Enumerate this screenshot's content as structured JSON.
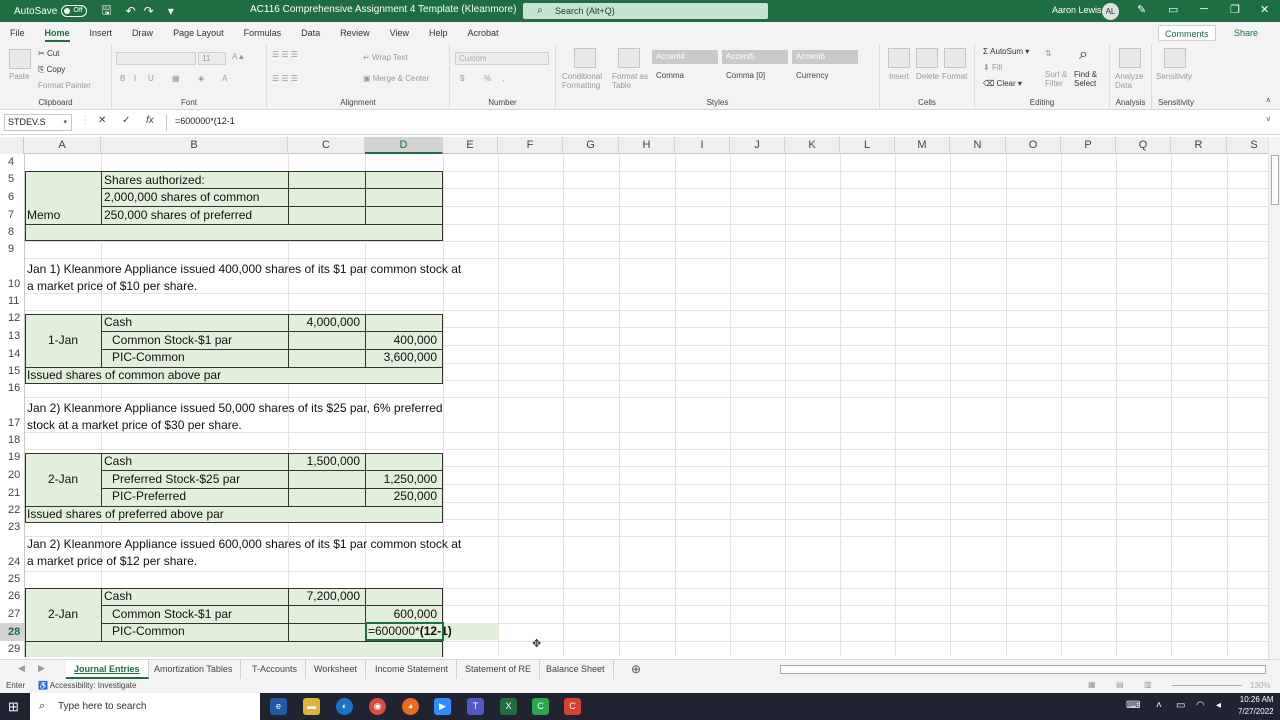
{
  "titlebar": {
    "autosave_label": "AutoSave",
    "autosave_state": "Off",
    "doc_title": "AC116 Comprehensive Assignment 4 Template (Kleanmore)",
    "search_placeholder": "Search (Alt+Q)",
    "user_name": "Aaron Lewis",
    "user_initials": "AL"
  },
  "ribbon_tabs": [
    "File",
    "Home",
    "Insert",
    "Draw",
    "Page Layout",
    "Formulas",
    "Data",
    "Review",
    "View",
    "Help",
    "Acrobat"
  ],
  "active_tab": "Home",
  "ribbon_actions": {
    "comments": "Comments",
    "share": "Share"
  },
  "ribbon": {
    "clipboard": {
      "label": "Clipboard",
      "paste": "Paste",
      "cut": "Cut",
      "copy": "Copy",
      "format_painter": "Format Painter"
    },
    "font": {
      "label": "Font",
      "bold": "B",
      "italic": "I",
      "underline": "U",
      "font_size": "11"
    },
    "alignment": {
      "label": "Alignment",
      "wrap_text": "Wrap Text",
      "merge_center": "Merge & Center"
    },
    "number": {
      "label": "Number",
      "format": "Custom",
      "percent": "%",
      "comma": ",",
      "currency": "$"
    },
    "styles": {
      "label": "Styles",
      "conditional": "Conditional Formatting",
      "format_table": "Format as Table",
      "cell_styles": [
        "Accent4",
        "Accent5",
        "Accent6",
        "Comma",
        "Comma [0]",
        "Currency"
      ]
    },
    "cells": {
      "label": "Cells",
      "insert": "Insert",
      "delete": "Delete",
      "format": "Format"
    },
    "editing": {
      "label": "Editing",
      "autosum": "AutoSum",
      "fill": "Fill",
      "clear": "Clear",
      "sort_filter": "Sort & Filter",
      "find_select": "Find & Select"
    },
    "analysis": {
      "label": "Analysis",
      "analyze_data": "Analyze Data"
    },
    "sensitivity": {
      "label": "Sensitivity",
      "sensitivity": "Sensitivity"
    }
  },
  "formula_bar": {
    "name_box": "STDEV.S",
    "cancel": "✕",
    "enter": "✓",
    "fx": "fx",
    "formula": "=600000*(12-1"
  },
  "columns": [
    "A",
    "B",
    "C",
    "D",
    "E",
    "F",
    "G",
    "H",
    "I",
    "J",
    "K",
    "L",
    "M",
    "N",
    "O",
    "P",
    "Q",
    "R",
    "S"
  ],
  "rows": [
    "4",
    "5",
    "6",
    "7",
    "8",
    "9",
    "10",
    "11",
    "12",
    "13",
    "14",
    "15",
    "16",
    "17",
    "18",
    "19",
    "20",
    "21",
    "22",
    "23",
    "24",
    "25",
    "26",
    "27",
    "28",
    "29"
  ],
  "cells": {
    "r5b": "Shares authorized:",
    "r6b": "2,000,000 shares of common",
    "r7a": "Memo",
    "r7b": "250,000 shares of preferred",
    "r10_line1": "Jan 1) Kleanmore Appliance issued 400,000 shares of its $1 par common stock at",
    "r10_line2": "a market price of $10 per share.",
    "r12b": "Cash",
    "r12c": "4,000,000",
    "r13a": "1-Jan",
    "r13b": "Common Stock-$1 par",
    "r13d": "400,000",
    "r14b": "PIC-Common",
    "r14d": "3,600,000",
    "r15a": "Issued shares of common above par",
    "r17_line1": "Jan 2) Kleanmore Appliance issued 50,000 shares of its $25 par, 6% preferred",
    "r17_line2": "stock at a market price of $30 per share.",
    "r19b": "Cash",
    "r19c": "1,500,000",
    "r20a": "2-Jan",
    "r20b": "Preferred Stock-$25 par",
    "r20d": "1,250,000",
    "r21b": "PIC-Preferred",
    "r21d": "250,000",
    "r22a": "Issued shares of preferred above par",
    "r24_line1": "Jan 2) Kleanmore Appliance issued 600,000 shares of its $1 par common stock at",
    "r24_line2": "a market price of $12 per share.",
    "r26b": "Cash",
    "r26c": "7,200,000",
    "r27a": "2-Jan",
    "r27b": "Common Stock-$1 par",
    "r27d": "600,000",
    "r28b": "PIC-Common",
    "r28d_prefix": "=600000*",
    "r28d_bold": "(12-1)"
  },
  "sheet_tabs": [
    "Journal Entries",
    "Amortization Tables",
    "T-Accounts",
    "Worksheet",
    "Income Statement",
    "Statement of RE",
    "Balance Sheet"
  ],
  "active_sheet": "Journal Entries",
  "status": {
    "mode": "Enter",
    "accessibility": "Accessibility: Investigate",
    "zoom": "130%"
  },
  "taskbar": {
    "search_placeholder": "Type here to search",
    "time": "10:26 AM",
    "date": "7/27/2022"
  },
  "colors": {
    "excel_green": "#1e6e42",
    "entry_fill": "#e2efda"
  }
}
